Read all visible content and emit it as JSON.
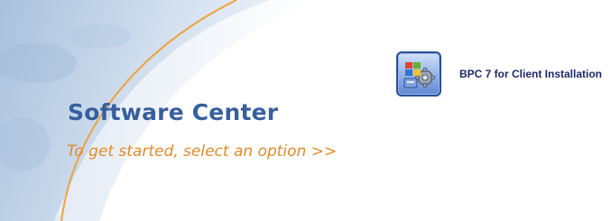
{
  "header": {
    "title": "Software Center",
    "subtitle": "To get started, select an option >>"
  },
  "options": [
    {
      "label": "BPC 7 for Client Installation",
      "icon": "installer-icon"
    }
  ],
  "colors": {
    "title": "#365f9e",
    "subtitle": "#e38a2a",
    "option_label": "#1c2a66",
    "swoosh": "#f0a238",
    "panel_blue": "#bcd0e6"
  }
}
